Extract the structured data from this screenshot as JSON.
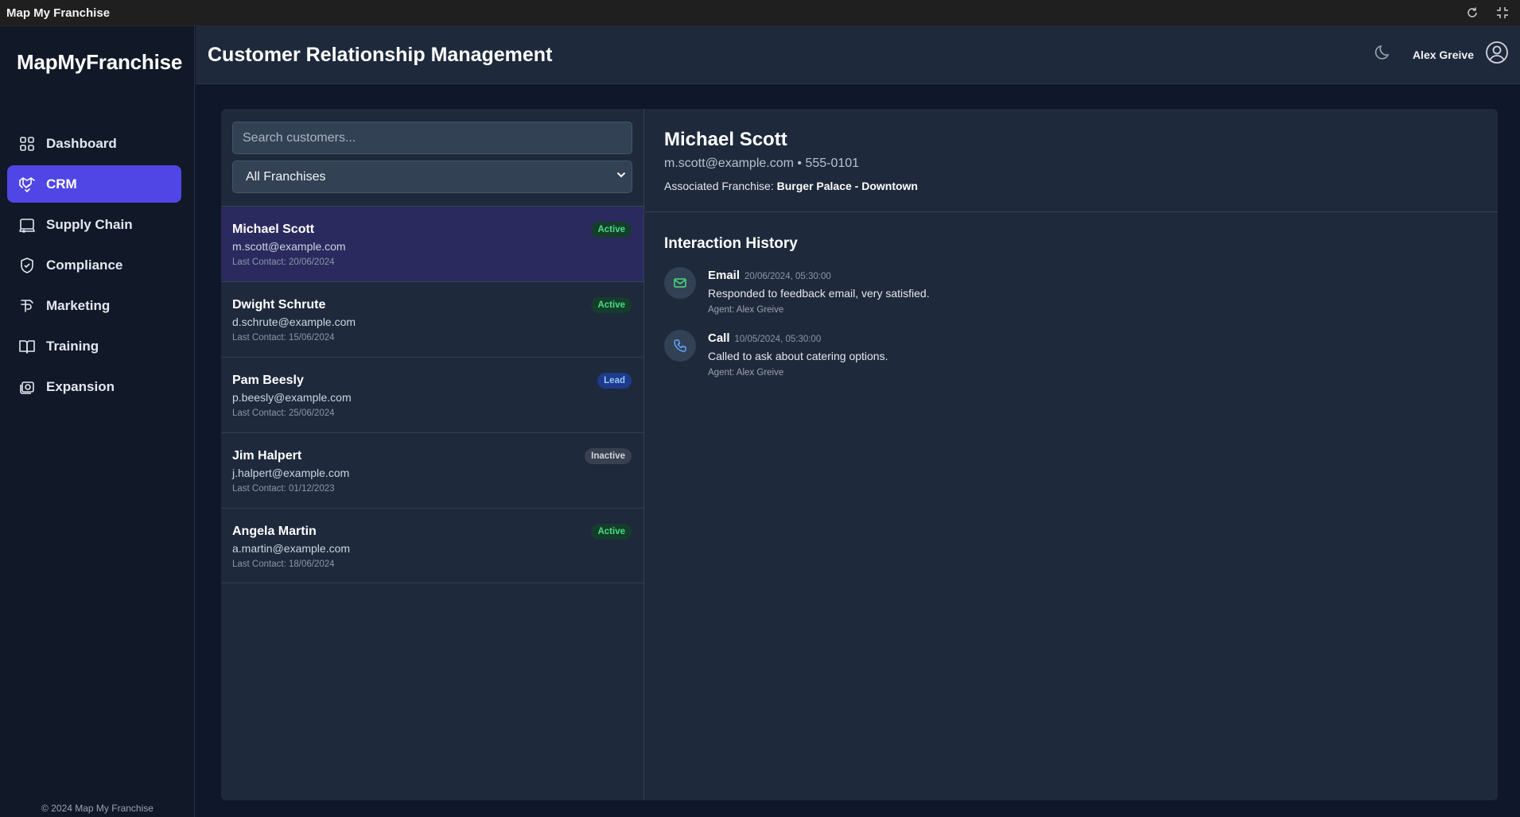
{
  "window": {
    "title": "Map My Franchise"
  },
  "sidebar": {
    "brand": "MapMyFranchise",
    "items": [
      {
        "label": "Dashboard",
        "icon": "dashboard-grid-icon"
      },
      {
        "label": "CRM",
        "icon": "handshake-icon",
        "active": true
      },
      {
        "label": "Supply Chain",
        "icon": "truck-icon"
      },
      {
        "label": "Compliance",
        "icon": "shield-icon"
      },
      {
        "label": "Marketing",
        "icon": "megaphone-icon"
      },
      {
        "label": "Training",
        "icon": "book-icon"
      },
      {
        "label": "Expansion",
        "icon": "expand-icon"
      }
    ],
    "copyright": "© 2024 Map My Franchise"
  },
  "header": {
    "title": "Customer Relationship Management",
    "user": "Alex Greive"
  },
  "list": {
    "search_placeholder": "Search customers...",
    "filter_selected": "All Franchises",
    "customers": [
      {
        "name": "Michael Scott",
        "email": "m.scott@example.com",
        "last_contact": "Last Contact: 20/06/2024",
        "status": "Active"
      },
      {
        "name": "Dwight Schrute",
        "email": "d.schrute@example.com",
        "last_contact": "Last Contact: 15/06/2024",
        "status": "Active"
      },
      {
        "name": "Pam Beesly",
        "email": "p.beesly@example.com",
        "last_contact": "Last Contact: 25/06/2024",
        "status": "Lead"
      },
      {
        "name": "Jim Halpert",
        "email": "j.halpert@example.com",
        "last_contact": "Last Contact: 01/12/2023",
        "status": "Inactive"
      },
      {
        "name": "Angela Martin",
        "email": "a.martin@example.com",
        "last_contact": "Last Contact: 18/06/2024",
        "status": "Active"
      }
    ]
  },
  "detail": {
    "name": "Michael Scott",
    "contact_line": "m.scott@example.com • 555-0101",
    "franchise_label": "Associated Franchise:",
    "franchise_value": "Burger Palace - Downtown",
    "history_title": "Interaction History",
    "interactions": [
      {
        "type": "Email",
        "date": "20/06/2024, 05:30:00",
        "description": "Responded to feedback email, very satisfied.",
        "agent": "Agent: Alex Greive",
        "icon": "mail-icon"
      },
      {
        "type": "Call",
        "date": "10/05/2024, 05:30:00",
        "description": "Called to ask about catering options.",
        "agent": "Agent: Alex Greive",
        "icon": "phone-icon"
      }
    ]
  },
  "colors": {
    "accent": "#4f46e5",
    "active_badge": "#4ade80",
    "lead_badge": "#93c5fd",
    "sidebar_bg": "#111827",
    "panel_bg": "#1e293b"
  }
}
